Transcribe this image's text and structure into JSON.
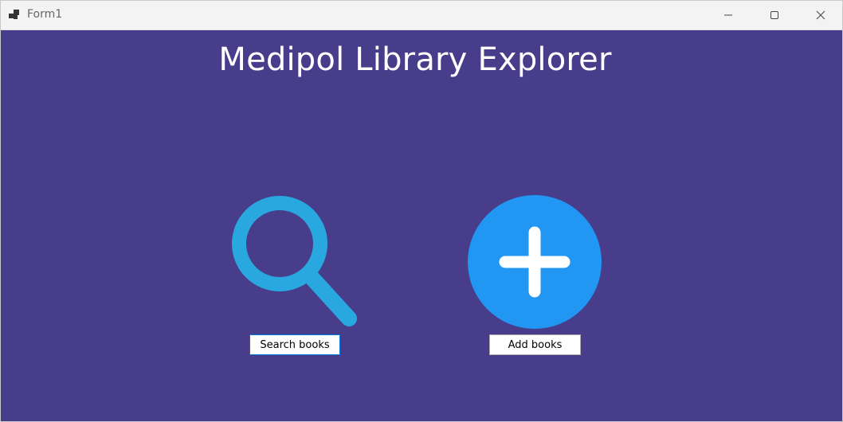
{
  "window": {
    "title": "Form1",
    "controls": {
      "minimize": "minimize-icon",
      "maximize": "maximize-icon",
      "close": "close-icon"
    }
  },
  "main": {
    "title": "Medipol Library Explorer",
    "search": {
      "icon": "magnifier-icon",
      "button_label": "Search books"
    },
    "add": {
      "icon": "plus-circle-icon",
      "button_label": "Add books"
    }
  },
  "colors": {
    "background": "#483d8b",
    "title_text": "#ffffff",
    "search_icon": "#29a8e0",
    "add_icon": "#2196f3"
  }
}
